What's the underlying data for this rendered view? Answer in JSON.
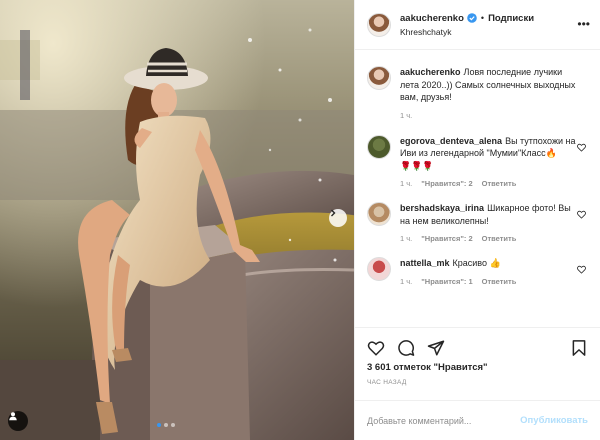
{
  "post": {
    "username": "aakucherenko",
    "follow_label": "Подписки",
    "separator": "•",
    "location": "Khreshchatyk",
    "caption": "Ловя последние лучики лета 2020..)) Самых солнечных выходных вам, друзья!",
    "caption_time": "1 ч."
  },
  "comments": [
    {
      "user": "egorova_denteva_alena",
      "text": "Вы тутпохожи на Иви из легендарной \"Мумии\"Класс🔥",
      "extra": "🌹🌹🌹",
      "time": "1 ч.",
      "likes": "\"Нравится\": 2",
      "reply": "Ответить"
    },
    {
      "user": "bershadskaya_irina",
      "text": "Шикарное фото! Вы на нем великолепны!",
      "time": "1 ч.",
      "likes": "\"Нравится\": 2",
      "reply": "Ответить"
    },
    {
      "user": "nattella_mk",
      "text": "Красиво 👍",
      "time": "1 ч.",
      "likes": "\"Нравится\": 1",
      "reply": "Ответить"
    }
  ],
  "actions": {
    "likes_count": "3 601",
    "likes_label": "отметок \"Нравится\"",
    "time_ago": "ЧАС НАЗАД",
    "comment_placeholder": "Добавьте комментарий...",
    "publish_label": "Опубликовать"
  },
  "carousel": {
    "slides": 3,
    "active": 0
  },
  "colors": {
    "accent": "#3897f0",
    "publish_disabled": "#b2dffc",
    "verified": "#3897f0"
  },
  "icons": [
    "next-arrow-icon",
    "tag-user-icon",
    "verified-icon",
    "more-icon",
    "heart-icon",
    "comment-icon",
    "share-icon",
    "bookmark-icon"
  ]
}
